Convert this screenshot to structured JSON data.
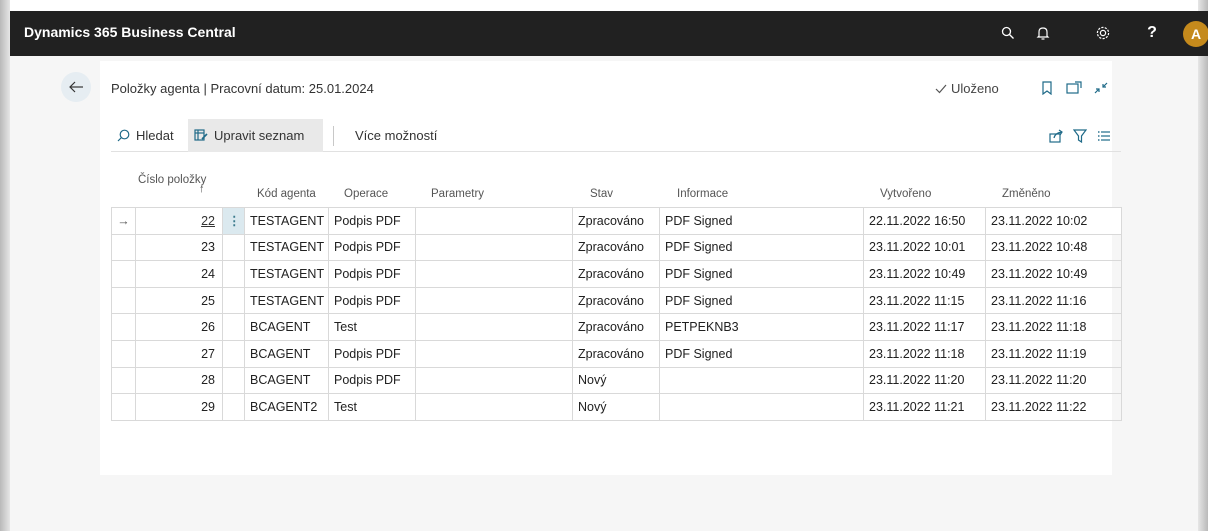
{
  "app": {
    "title": "Dynamics 365 Business Central",
    "avatar_initial": "A",
    "icons": [
      "search-icon",
      "bell-icon",
      "gear-icon",
      "help-icon"
    ]
  },
  "page": {
    "caption": "Položky agenta | Pracovní datum: 25.01.2024",
    "saved_label": "Uloženo"
  },
  "actions": {
    "search": "Hledat",
    "edit_list": "Upravit seznam",
    "more": "Více možností"
  },
  "columns": {
    "entry_no": "Číslo položky",
    "agent_code": "Kód agenta",
    "operation": "Operace",
    "parameters": "Parametry",
    "status": "Stav",
    "info": "Informace",
    "created": "Vytvořeno",
    "modified": "Změněno"
  },
  "rows": [
    {
      "entry_no": "22",
      "agent_code": "TESTAGENT",
      "operation": "Podpis PDF",
      "parameters": "",
      "status": "Zpracováno",
      "info": "PDF Signed",
      "created": "22.11.2022 16:50",
      "modified": "23.11.2022 10:02"
    },
    {
      "entry_no": "23",
      "agent_code": "TESTAGENT",
      "operation": "Podpis PDF",
      "parameters": "",
      "status": "Zpracováno",
      "info": "PDF Signed",
      "created": "23.11.2022 10:01",
      "modified": "23.11.2022 10:48"
    },
    {
      "entry_no": "24",
      "agent_code": "TESTAGENT",
      "operation": "Podpis PDF",
      "parameters": "",
      "status": "Zpracováno",
      "info": "PDF Signed",
      "created": "23.11.2022 10:49",
      "modified": "23.11.2022 10:49"
    },
    {
      "entry_no": "25",
      "agent_code": "TESTAGENT",
      "operation": "Podpis PDF",
      "parameters": "",
      "status": "Zpracováno",
      "info": "PDF Signed",
      "created": "23.11.2022 11:15",
      "modified": "23.11.2022 11:16"
    },
    {
      "entry_no": "26",
      "agent_code": "BCAGENT",
      "operation": "Test",
      "parameters": "",
      "status": "Zpracováno",
      "info": "PETPEKNB3",
      "created": "23.11.2022 11:17",
      "modified": "23.11.2022 11:18"
    },
    {
      "entry_no": "27",
      "agent_code": "BCAGENT",
      "operation": "Podpis PDF",
      "parameters": "",
      "status": "Zpracováno",
      "info": "PDF Signed",
      "created": "23.11.2022 11:18",
      "modified": "23.11.2022 11:19"
    },
    {
      "entry_no": "28",
      "agent_code": "BCAGENT",
      "operation": "Podpis PDF",
      "parameters": "",
      "status": "Nový",
      "info": "",
      "created": "23.11.2022 11:20",
      "modified": "23.11.2022 11:20"
    },
    {
      "entry_no": "29",
      "agent_code": "BCAGENT2",
      "operation": "Test",
      "parameters": "",
      "status": "Nový",
      "info": "",
      "created": "23.11.2022 11:21",
      "modified": "23.11.2022 11:22"
    }
  ],
  "colors": {
    "appbar": "#212121",
    "accent": "#3b7a8c",
    "avatar": "#c58a1c"
  }
}
